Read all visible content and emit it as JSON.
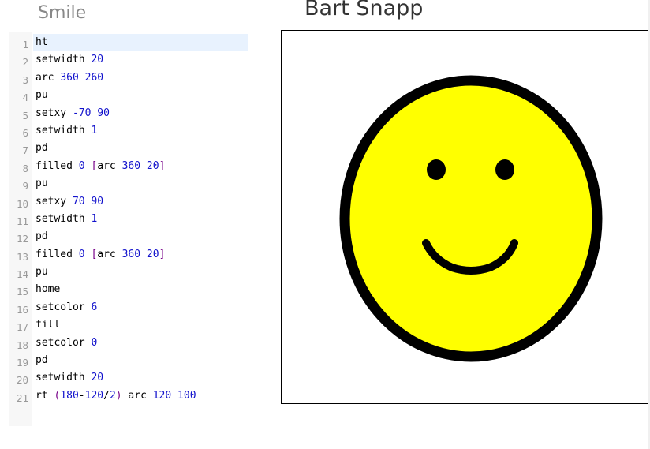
{
  "program": {
    "title": "Smile"
  },
  "author": {
    "name": "Bart Snapp"
  },
  "editor": {
    "active_line": 1,
    "lines": [
      [
        {
          "t": "ht",
          "k": "kw"
        }
      ],
      [
        {
          "t": "setwidth ",
          "k": "kw"
        },
        {
          "t": "20",
          "k": "num"
        }
      ],
      [
        {
          "t": "arc ",
          "k": "kw"
        },
        {
          "t": "360",
          "k": "num"
        },
        {
          "t": " ",
          "k": "kw"
        },
        {
          "t": "260",
          "k": "num"
        }
      ],
      [
        {
          "t": "pu",
          "k": "kw"
        }
      ],
      [
        {
          "t": "setxy ",
          "k": "kw"
        },
        {
          "t": "-70",
          "k": "num"
        },
        {
          "t": " ",
          "k": "kw"
        },
        {
          "t": "90",
          "k": "num"
        }
      ],
      [
        {
          "t": "setwidth ",
          "k": "kw"
        },
        {
          "t": "1",
          "k": "num"
        }
      ],
      [
        {
          "t": "pd",
          "k": "kw"
        }
      ],
      [
        {
          "t": "filled ",
          "k": "kw"
        },
        {
          "t": "0",
          "k": "num"
        },
        {
          "t": " ",
          "k": "kw"
        },
        {
          "t": "[",
          "k": "bracket"
        },
        {
          "t": "arc ",
          "k": "kw"
        },
        {
          "t": "360",
          "k": "num"
        },
        {
          "t": " ",
          "k": "kw"
        },
        {
          "t": "20",
          "k": "num"
        },
        {
          "t": "]",
          "k": "bracket"
        }
      ],
      [
        {
          "t": "pu",
          "k": "kw"
        }
      ],
      [
        {
          "t": "setxy ",
          "k": "kw"
        },
        {
          "t": "70",
          "k": "num"
        },
        {
          "t": " ",
          "k": "kw"
        },
        {
          "t": "90",
          "k": "num"
        }
      ],
      [
        {
          "t": "setwidth ",
          "k": "kw"
        },
        {
          "t": "1",
          "k": "num"
        }
      ],
      [
        {
          "t": "pd",
          "k": "kw"
        }
      ],
      [
        {
          "t": "filled ",
          "k": "kw"
        },
        {
          "t": "0",
          "k": "num"
        },
        {
          "t": " ",
          "k": "kw"
        },
        {
          "t": "[",
          "k": "bracket"
        },
        {
          "t": "arc ",
          "k": "kw"
        },
        {
          "t": "360",
          "k": "num"
        },
        {
          "t": " ",
          "k": "kw"
        },
        {
          "t": "20",
          "k": "num"
        },
        {
          "t": "]",
          "k": "bracket"
        }
      ],
      [
        {
          "t": "pu",
          "k": "kw"
        }
      ],
      [
        {
          "t": "home",
          "k": "kw"
        }
      ],
      [
        {
          "t": "setcolor ",
          "k": "kw"
        },
        {
          "t": "6",
          "k": "num"
        }
      ],
      [
        {
          "t": "fill",
          "k": "kw"
        }
      ],
      [
        {
          "t": "setcolor ",
          "k": "kw"
        },
        {
          "t": "0",
          "k": "num"
        }
      ],
      [
        {
          "t": "pd",
          "k": "kw"
        }
      ],
      [
        {
          "t": "setwidth ",
          "k": "kw"
        },
        {
          "t": "20",
          "k": "num"
        }
      ],
      [
        {
          "t": "rt ",
          "k": "kw"
        },
        {
          "t": "(",
          "k": "bracket"
        },
        {
          "t": "180",
          "k": "num"
        },
        {
          "t": "-",
          "k": "kw"
        },
        {
          "t": "120",
          "k": "num"
        },
        {
          "t": "/",
          "k": "kw"
        },
        {
          "t": "2",
          "k": "num"
        },
        {
          "t": ")",
          "k": "bracket"
        },
        {
          "t": " arc ",
          "k": "kw"
        },
        {
          "t": "120",
          "k": "num"
        },
        {
          "t": " ",
          "k": "kw"
        },
        {
          "t": "100",
          "k": "num"
        }
      ]
    ]
  },
  "drawing": {
    "face_fill": "#ffff00",
    "stroke_color": "#000000",
    "background": "#ffffff"
  }
}
